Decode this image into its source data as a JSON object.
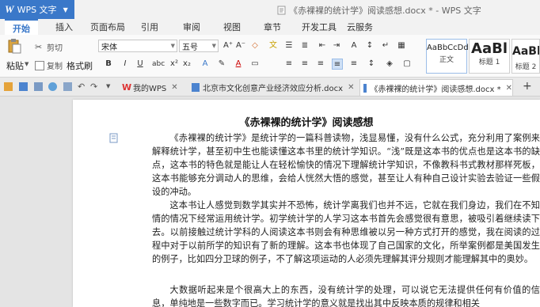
{
  "titlebar": {
    "app_logo": "W",
    "app_name": "WPS 文字",
    "doc_title": "《赤裸裸的统计学》阅读感想.docx * - WPS 文字"
  },
  "ribbon_tabs": [
    "开始",
    "插入",
    "页面布局",
    "引用",
    "审阅",
    "视图",
    "章节",
    "开发工具",
    "云服务"
  ],
  "ribbon": {
    "paste_label": "粘贴",
    "cut_label": "剪切",
    "copy_label": "复制",
    "format_painter_label": "格式刷",
    "font_name": "宋体",
    "font_size": "五号",
    "styles": [
      {
        "preview": "AaBbCcDd",
        "name": "正文"
      },
      {
        "preview": "AaBl",
        "name": "标题 1"
      },
      {
        "preview": "AaBb",
        "name": "标题 2"
      }
    ]
  },
  "doc_tabs": [
    {
      "label": "我的WPS"
    },
    {
      "label": "北京市文化创意产业经济效应分析.docx"
    },
    {
      "label": "《赤裸裸的统计学》阅读感想.docx *"
    }
  ],
  "document": {
    "title": "《赤裸裸的统计学》阅读感想",
    "paragraphs": [
      "《赤裸裸的统计学》是统计学的一篇科普读物，浅显易懂，没有什么公式，充分利用了案例来解释统计学，甚至初中生也能读懂这本书里的统计学知识。“浅”既是这本书的优点也是这本书的缺点，这本书的特色就是能让人在轻松愉快的情况下理解统计学知识，不像教科书式教材那样死板，这本书能够充分调动人的思维，会给人恍然大悟的感觉，甚至让人有种自己设计实验去验证一些假设的冲动。",
      "这本书让人感觉到数学其实并不恐怖，统计学离我们也并不远，它就在我们身边，我们在不知情的情况下经常运用统计学。初学统计学的人学习这本书首先会感觉很有意思，被吸引着继续读下去。以前接触过统计学科的人阅读这本书则会有种思维被以另一种方式打开的感觉，我在阅读的过程中对于以前所学的知识有了新的理解。这本书也体现了自己国家的文化，所举案例都是美国发生的例子，比如四分卫球的例子，不了解这项运动的人必须先理解其评分规则才能理解其中的奥妙。",
      "大数据听起来是个很高大上的东西，没有统计学的处理，可以说它无法提供任何有价值的信息，单纯地是一些数字而已。学习统计学的意义就是找出其中反映本质的规律和相关"
    ]
  }
}
